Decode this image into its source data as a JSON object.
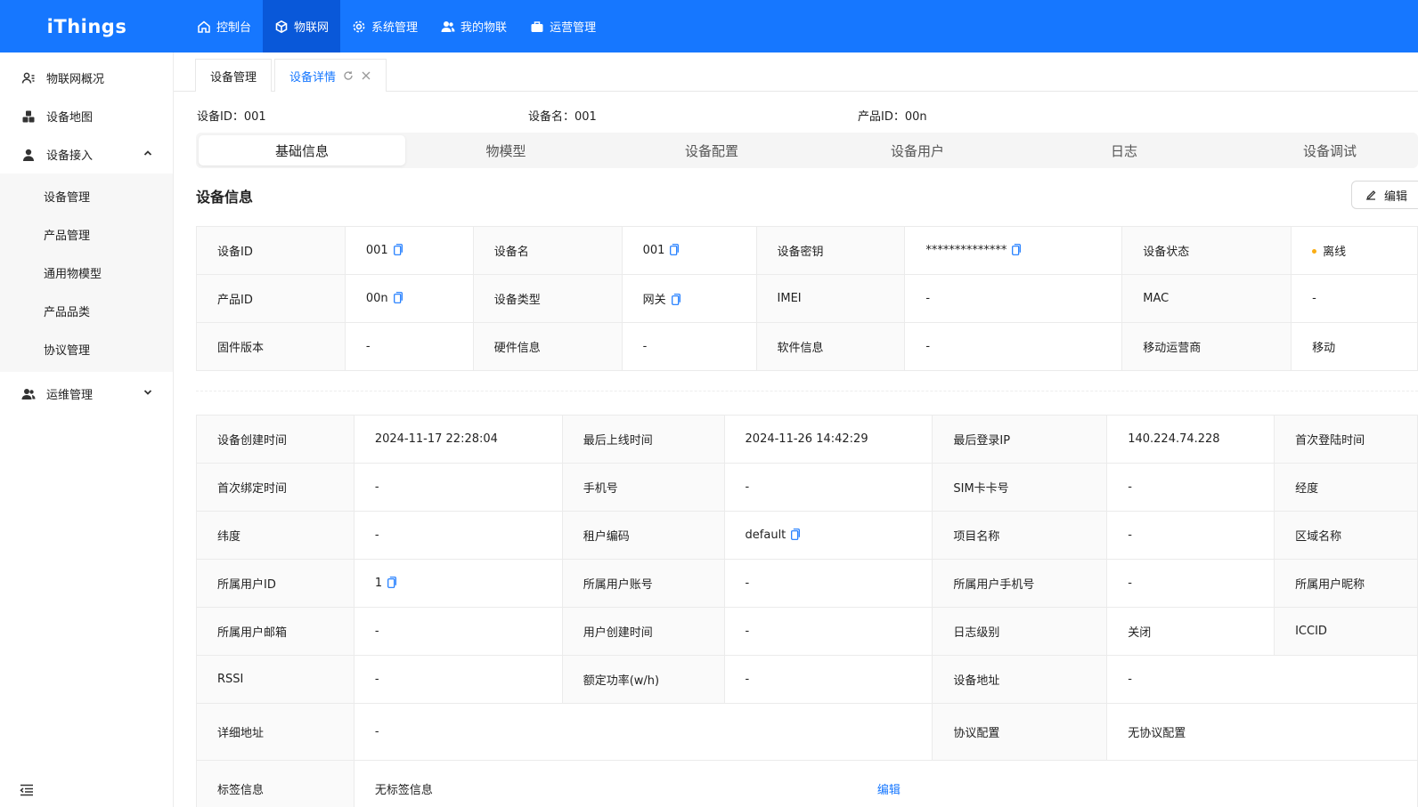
{
  "app": {
    "logo": "iThings"
  },
  "topnav": [
    {
      "label": "控制台",
      "icon": "home-icon"
    },
    {
      "label": "物联网",
      "icon": "cube-icon",
      "active": true
    },
    {
      "label": "系统管理",
      "icon": "gear-icon"
    },
    {
      "label": "我的物联",
      "icon": "users-icon"
    },
    {
      "label": "运营管理",
      "icon": "briefcase-icon"
    }
  ],
  "sidebar": {
    "items": [
      {
        "label": "物联网概况",
        "icon": "overview-icon"
      },
      {
        "label": "设备地图",
        "icon": "map-cubes-icon"
      },
      {
        "label": "设备接入",
        "icon": "user-icon",
        "expanded": true,
        "children": [
          "设备管理",
          "产品管理",
          "通用物模型",
          "产品品类",
          "协议管理"
        ]
      },
      {
        "label": "运维管理",
        "icon": "team-icon",
        "expanded": false
      }
    ]
  },
  "tabs": [
    {
      "label": "设备管理",
      "active": false
    },
    {
      "label": "设备详情",
      "active": true
    }
  ],
  "header": {
    "device_id": "设备ID：001",
    "device_name": "设备名：001",
    "product_id": "产品ID：00n"
  },
  "segments": [
    "基础信息",
    "物模型",
    "设备配置",
    "设备用户",
    "日志",
    "设备调试"
  ],
  "section": {
    "title": "设备信息",
    "edit_label": "编辑"
  },
  "info_table": [
    [
      {
        "l": "设备ID",
        "v": "001",
        "copy": true
      },
      {
        "l": "设备名",
        "v": "001",
        "copy": true
      },
      {
        "l": "设备密钥",
        "v": "**************",
        "copy": true
      },
      {
        "l": "设备状态",
        "v": "离线",
        "status_color": "#faad14"
      }
    ],
    [
      {
        "l": "产品ID",
        "v": "00n",
        "copy": true
      },
      {
        "l": "设备类型",
        "v": "网关",
        "copy": true
      },
      {
        "l": "IMEI",
        "v": "-"
      },
      {
        "l": "MAC",
        "v": "-"
      }
    ],
    [
      {
        "l": "固件版本",
        "v": "-"
      },
      {
        "l": "硬件信息",
        "v": "-"
      },
      {
        "l": "软件信息",
        "v": "-"
      },
      {
        "l": "移动运营商",
        "v": "移动"
      }
    ]
  ],
  "detail_table": [
    [
      {
        "l": "设备创建时间",
        "v": "2024-11-17 22:28:04"
      },
      {
        "l": "最后上线时间",
        "v": "2024-11-26 14:42:29"
      },
      {
        "l": "最后登录IP",
        "v": "140.224.74.228"
      },
      {
        "l": "首次登陆时间"
      }
    ],
    [
      {
        "l": "首次绑定时间",
        "v": "-"
      },
      {
        "l": "手机号",
        "v": "-"
      },
      {
        "l": "SIM卡卡号",
        "v": "-"
      },
      {
        "l": "经度"
      }
    ],
    [
      {
        "l": "纬度",
        "v": "-"
      },
      {
        "l": "租户编码",
        "v": "default",
        "copy": true
      },
      {
        "l": "项目名称",
        "v": "-"
      },
      {
        "l": "区域名称"
      }
    ],
    [
      {
        "l": "所属用户ID",
        "v": "1",
        "copy": true
      },
      {
        "l": "所属用户账号",
        "v": "-"
      },
      {
        "l": "所属用户手机号",
        "v": "-"
      },
      {
        "l": "所属用户昵称"
      }
    ],
    [
      {
        "l": "所属用户邮箱",
        "v": "-"
      },
      {
        "l": "用户创建时间",
        "v": "-"
      },
      {
        "l": "日志级别",
        "v": "关闭"
      },
      {
        "l": "ICCID"
      }
    ],
    [
      {
        "l": "RSSI",
        "v": "-"
      },
      {
        "l": "额定功率(w/h)",
        "v": "-"
      },
      {
        "l": "设备地址",
        "v": "-"
      }
    ],
    [
      {
        "l": "详细地址",
        "v": "-"
      },
      {
        "l": "协议配置",
        "v": "无协议配置"
      }
    ],
    [
      {
        "l": "标签信息",
        "v": "无标签信息",
        "link": "编辑"
      }
    ]
  ],
  "colors": {
    "primary": "#1677ff",
    "active_nav": "#0958d9",
    "offline": "#faad14"
  }
}
